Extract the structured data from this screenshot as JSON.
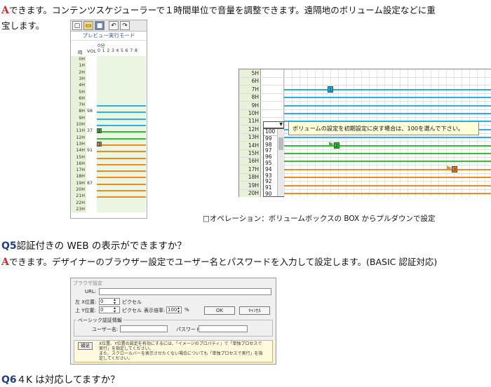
{
  "intro": {
    "marker": "A",
    "line1": "できます。コンテンツスケジューラーで１時間単位で音量を調整できます。遠隔地のボリューム設定などに重",
    "line2": "宝します。"
  },
  "scheduler_small": {
    "toolbar_icons": [
      "new-icon",
      "open-icon",
      "save-icon",
      "undo-icon",
      "redo-icon"
    ],
    "mode_title": "プレビュー実行モード",
    "minute_label": "0分",
    "col_hour": "時",
    "col_vol": "VOL",
    "minute_ticks": [
      "0",
      "1",
      "2",
      "3",
      "4",
      "5",
      "6",
      "7",
      "8"
    ],
    "hours": [
      "0H",
      "1H",
      "2H",
      "3H",
      "4H",
      "5H",
      "6H",
      "7H",
      "8H",
      "9H",
      "10H",
      "11H",
      "12H",
      "13H",
      "14H",
      "15H",
      "16H",
      "17H",
      "18H",
      "19H",
      "20H",
      "21H",
      "22H",
      "23H"
    ],
    "volumes": {
      "8H": "98",
      "11H": "37",
      "14H": "91",
      "19H": "87"
    },
    "markers": [
      {
        "label": "2",
        "hour": "11H"
      },
      {
        "label": "3",
        "hour": "13H"
      }
    ],
    "colors": {
      "blue": "#29b0e8",
      "green": "#2fc42f",
      "orange": "#f08a1c"
    }
  },
  "scheduler_large": {
    "hours": [
      "5H",
      "6H",
      "7H",
      "8H",
      "9H",
      "10H",
      "11H",
      "12H",
      "13H",
      "14H",
      "15H",
      "16H",
      "17H",
      "18H",
      "19H",
      "20H"
    ],
    "dropdown_selected": "",
    "dropdown_options": [
      "100",
      "99",
      "98",
      "97",
      "96",
      "95",
      "94",
      "93",
      "92",
      "91",
      "90"
    ],
    "tooltip": "ボリュームの設定を初期設定に戻す場合は、100を選んで下さい。",
    "markers": [
      {
        "label": "1",
        "hour": "7H"
      },
      {
        "label": "2",
        "hour": "14H"
      },
      {
        "label": "3",
        "hour": "17H"
      }
    ]
  },
  "caption": "□オペレーション：ボリュームボックスの BOX からプルダウンで設定",
  "q5": {
    "marker": "Q5",
    "question": "認証付きの WEB の表示ができますか？",
    "answer_marker": "A",
    "answer": "できます。デザイナーのブラウザー設定でユーザー名とパスワードを入力して設定します。(BASIC 認証対応)"
  },
  "browser_dialog": {
    "title": "ブラウザ設定",
    "url_label": "URL:",
    "url_value": "",
    "left_pos_label": "左 X位置:",
    "left_pos_value": "0",
    "top_pos_label": "上 Y位置:",
    "top_pos_value": "0",
    "unit": "ピクセル",
    "zoom_label": "表示倍率:",
    "zoom_value": "100",
    "zoom_unit": "%",
    "ok": "OK",
    "cancel": "ｷｬﾝｾﾙ",
    "basic_auth_group": "ベーシック認証情報",
    "username_label": "ユーザー名:",
    "username_value": "",
    "password_label": "パスワード:",
    "password_value": "",
    "note_tag": "補足",
    "note_line1": "X位置、Y位置の設定を有効にするには、「イメージのプロパティ」で「単独プロセスで",
    "note_line2": "実行」を指定してください。",
    "note_line3": "また、スクロールバーを表示させたくない場合についても「単独プロセスで実行」を指",
    "note_line4": "定してください。"
  },
  "q6": {
    "marker": "Q6",
    "question": "４K は対応してますか？"
  }
}
